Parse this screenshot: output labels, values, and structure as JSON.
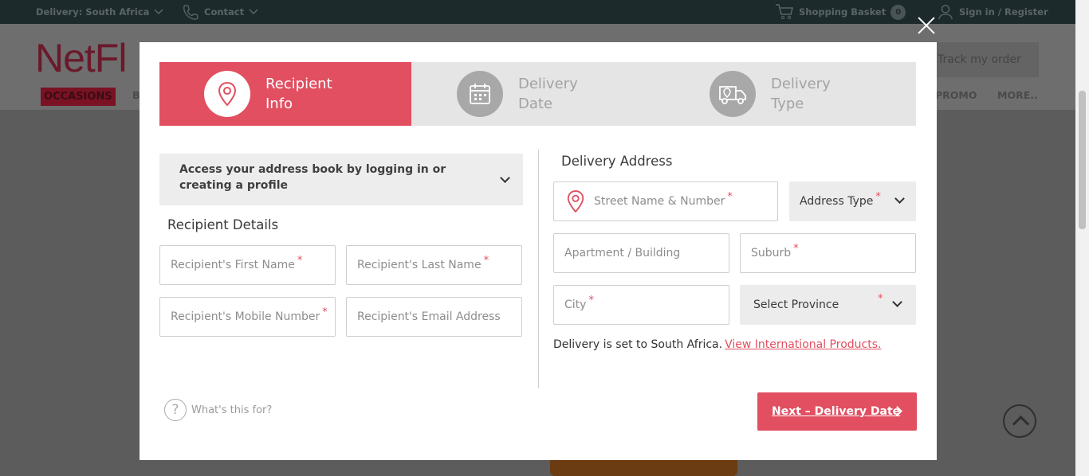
{
  "topbar": {
    "delivery": "Delivery: South Africa",
    "contact": "Contact",
    "basket": "Shopping Basket",
    "basket_count": "0",
    "signin": "Sign in / Register"
  },
  "header": {
    "logo": "NetFl",
    "track": "Track my order",
    "nav": {
      "occasions": "OCCASIONS",
      "b": "B",
      "promo": "PROMO",
      "more": "MORE.."
    }
  },
  "steps": [
    {
      "label": "Recipient Info",
      "icon": "location-pin-icon",
      "active": true
    },
    {
      "label": "Delivery Date",
      "icon": "calendar-icon",
      "active": false
    },
    {
      "label": "Delivery Type",
      "icon": "delivery-truck-icon",
      "active": false
    }
  ],
  "address_book": "Access your address book by logging in or creating a profile",
  "recipient": {
    "title": "Recipient Details",
    "first_name": "Recipient's First Name",
    "last_name": "Recipient's Last Name",
    "mobile": "Recipient's Mobile Number",
    "email": "Recipient's Email Address"
  },
  "delivery": {
    "title": "Delivery Address",
    "street": "Street Name & Number",
    "address_type": "Address Type",
    "apartment": "Apartment / Building",
    "suburb": "Suburb",
    "city": "City",
    "province": "Select Province",
    "note": "Delivery is set to South Africa.",
    "intl_link": "View International Products."
  },
  "help": "What's this for?",
  "next_button": "Next – Delivery Date",
  "colors": {
    "accent": "#e14f61",
    "topbar": "#1d2a2c"
  }
}
